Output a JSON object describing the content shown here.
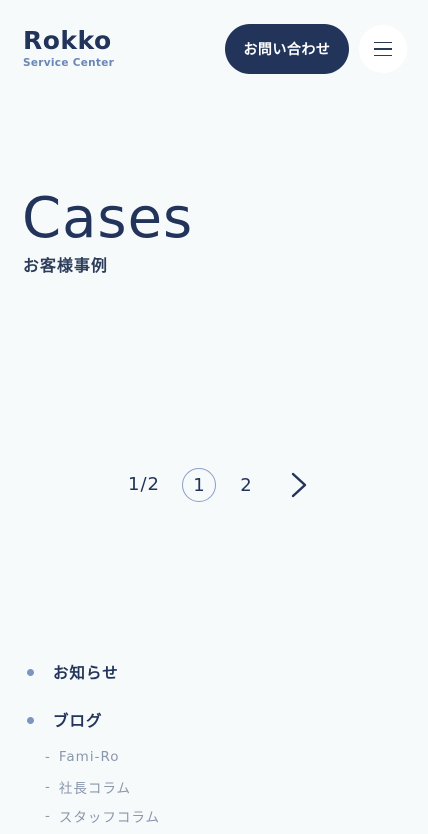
{
  "header": {
    "logo_main": "Rokko",
    "logo_sub": "Service Center",
    "contact_label": "お問い合わせ",
    "menu_icon": "hamburger-menu-icon"
  },
  "hero": {
    "title": "Cases",
    "subtitle": "お客様事例"
  },
  "pagination": {
    "count": "1/2",
    "pages": [
      "1",
      "2"
    ],
    "current_page": "1",
    "next_icon": "chevron-right-icon"
  },
  "footer_nav": {
    "items": [
      {
        "label": "お知らせ"
      },
      {
        "label": "ブログ",
        "children": [
          "Fami-Ro",
          "社長コラム",
          "スタッフコラム"
        ]
      }
    ],
    "dash": "-"
  },
  "colors": {
    "background": "#f7fafb",
    "navy": "#22345a",
    "accent": "#7d93c0",
    "muted_text": "#8a97ac"
  }
}
